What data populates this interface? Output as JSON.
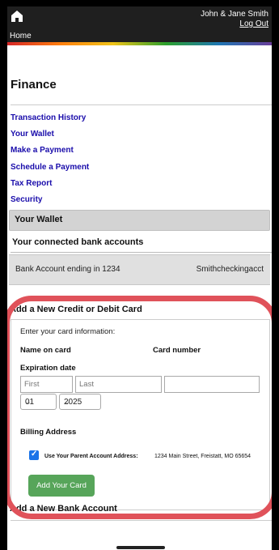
{
  "header": {
    "home_label": "Home",
    "user_name": "John & Jane Smith",
    "logout_label": "Log Out"
  },
  "page": {
    "title": "Finance"
  },
  "nav": {
    "items": [
      "Transaction History",
      "Your Wallet",
      "Make a Payment",
      "Schedule a Payment",
      "Tax Report",
      "Security"
    ]
  },
  "wallet": {
    "section_title": "Your Wallet",
    "connected_title": "Your connected bank accounts",
    "accounts": [
      {
        "label": "Bank Account ending in 1234",
        "nickname": "Smithcheckingacct"
      }
    ]
  },
  "card_form": {
    "title": "Add a New Credit or Debit Card",
    "instructions": "Enter your card information:",
    "name_label": "Name on card",
    "card_number_label": "Card number",
    "expiration_label": "Expiration date",
    "first_placeholder": "First",
    "last_placeholder": "Last",
    "month_value": "01",
    "year_value": "2025",
    "billing_label": "Billing Address",
    "use_parent_label": "Use Your Parent Account Address:",
    "parent_address": "1234 Main Street, Freistatt, MO 65654",
    "use_parent_checked": true,
    "submit_label": "Add Your Card"
  },
  "bank_form": {
    "title": "Add a New Bank Account"
  },
  "colors": {
    "header_bg": "#1f1f1f",
    "link": "#1a0dab",
    "button": "#57a55a",
    "checkbox": "#1a73e8",
    "highlight": "#e0525a"
  }
}
